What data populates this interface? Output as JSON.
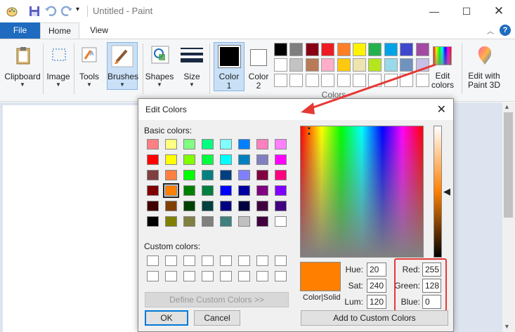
{
  "window": {
    "title": "Untitled - Paint"
  },
  "menu": {
    "file": "File",
    "tabs": [
      {
        "label": "Home",
        "active": true
      },
      {
        "label": "View",
        "active": false
      }
    ]
  },
  "ribbon": {
    "clipboard": "Clipboard",
    "image": "Image",
    "tools": "Tools",
    "brushes": "Brushes",
    "shapes": "Shapes",
    "size": "Size",
    "color1": [
      "Color",
      "1"
    ],
    "color2": [
      "Color",
      "2"
    ],
    "edit_colors": [
      "Edit",
      "colors"
    ],
    "paint3d": [
      "Edit with",
      "Paint 3D"
    ],
    "colors_group": "Colors",
    "palette": [
      "#000000",
      "#7f7f7f",
      "#880015",
      "#ed1c24",
      "#ff7f27",
      "#fff200",
      "#22b14c",
      "#00a2e8",
      "#3f48cc",
      "#a349a4",
      "#ffffff",
      "#c3c3c3",
      "#b97a57",
      "#ffaec9",
      "#ffc90e",
      "#efe4b0",
      "#b5e61d",
      "#99d9ea",
      "#7092be",
      "#c8bfe7"
    ]
  },
  "dialog": {
    "title": "Edit Colors",
    "basic_label": "Basic colors:",
    "custom_label": "Custom colors:",
    "basic_colors": [
      "#ff8080",
      "#ffff80",
      "#80ff80",
      "#00ff80",
      "#80ffff",
      "#0080ff",
      "#ff80c0",
      "#ff80ff",
      "#ff0000",
      "#ffff00",
      "#80ff00",
      "#00ff40",
      "#00ffff",
      "#0080c0",
      "#8080c0",
      "#ff00ff",
      "#804040",
      "#ff8040",
      "#00ff00",
      "#008080",
      "#004080",
      "#8080ff",
      "#800040",
      "#ff0080",
      "#800000",
      "#ff8000",
      "#008000",
      "#008040",
      "#0000ff",
      "#0000a0",
      "#800080",
      "#8000ff",
      "#400000",
      "#804000",
      "#004000",
      "#004040",
      "#000080",
      "#000040",
      "#400040",
      "#400080",
      "#000000",
      "#808000",
      "#808040",
      "#808080",
      "#408080",
      "#c0c0c0",
      "#400040",
      "#ffffff"
    ],
    "selected_index": 25,
    "define_custom": "Define Custom Colors >>",
    "ok": "OK",
    "cancel": "Cancel",
    "color_solid": "Color|Solid",
    "current_color": "#ff8000",
    "hue_label": "Hue:",
    "hue": "20",
    "sat_label": "Sat:",
    "sat": "240",
    "lum_label": "Lum:",
    "lum": "120",
    "red_label": "Red:",
    "red": "255",
    "green_label": "Green:",
    "green": "128",
    "blue_label": "Blue:",
    "blue": "0",
    "add_custom": "Add to Custom Colors"
  },
  "annotation": {
    "highlight_color": "#e53935"
  }
}
